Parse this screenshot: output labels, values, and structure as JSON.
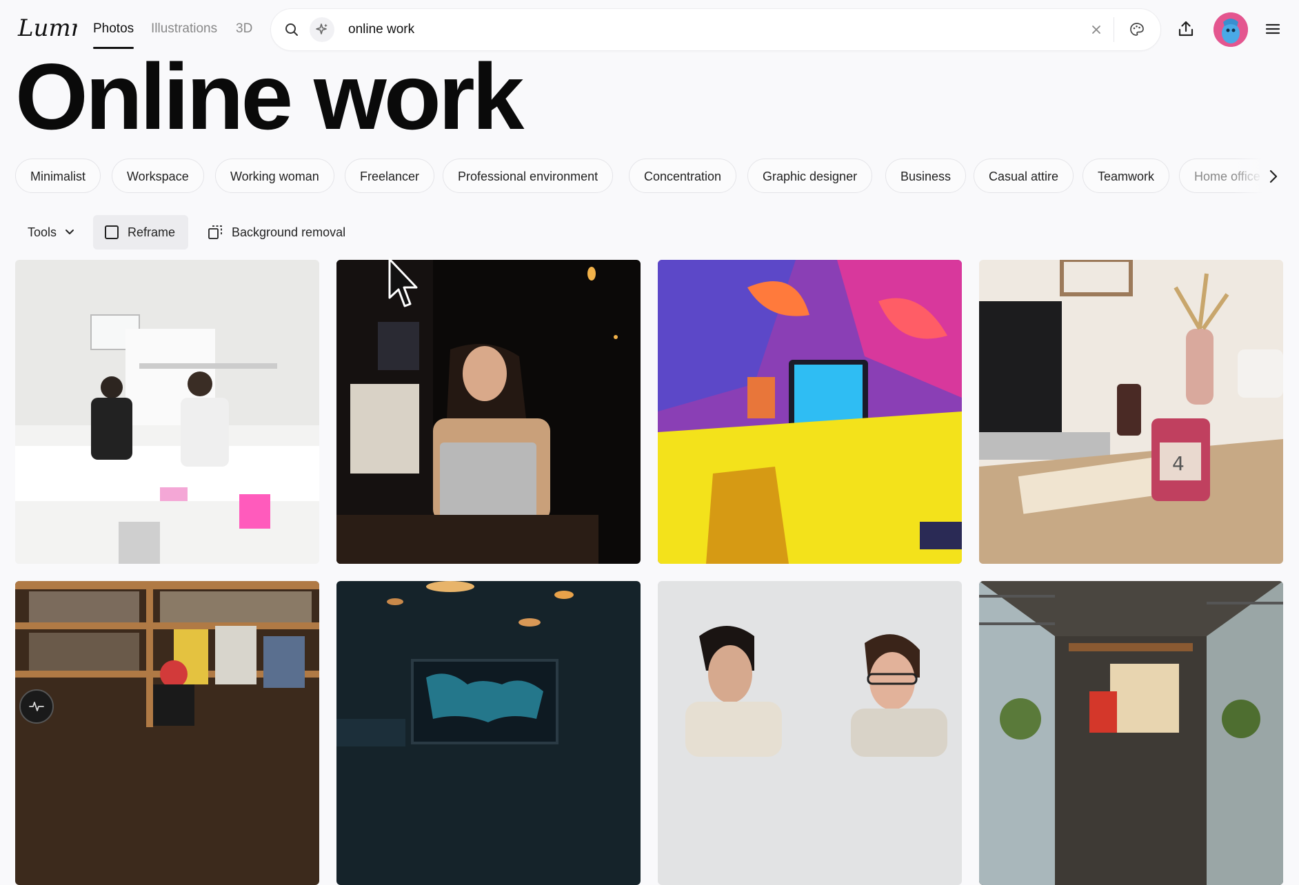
{
  "app": {
    "brand": "Lummi"
  },
  "nav": {
    "tabs": [
      {
        "label": "Photos",
        "active": true
      },
      {
        "label": "Illustrations",
        "active": false
      },
      {
        "label": "3D",
        "active": false
      }
    ]
  },
  "search": {
    "value": "online work"
  },
  "page": {
    "title": "Online work"
  },
  "chips": [
    "Minimalist",
    "Workspace",
    "Working woman",
    "Freelancer",
    "Professional environment",
    "Concentration",
    "Graphic designer",
    "Business",
    "Casual attire",
    "Teamwork",
    "Home office"
  ],
  "tools": {
    "tools_label": "Tools",
    "reframe_label": "Reframe",
    "background_removal_label": "Background removal"
  },
  "icons": {
    "search": "search-icon",
    "sparkle": "sparkle-icon",
    "clear": "close-icon",
    "palette": "palette-icon",
    "upload": "upload-icon",
    "menu": "menu-icon",
    "chevron": "chevron-right-icon",
    "status": "activity-icon"
  },
  "colors": {
    "background": "#f9f9fb",
    "text": "#111111",
    "chip_border": "#e4e4e8"
  }
}
